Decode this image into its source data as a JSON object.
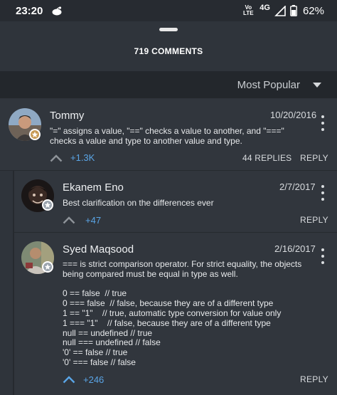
{
  "status": {
    "time": "23:20",
    "volte_top": "Vo",
    "volte_bottom": "LTE",
    "network": "4G",
    "battery": "62%"
  },
  "sheet": {
    "comments_count": "719 COMMENTS",
    "sort_label": "Most Popular"
  },
  "comments": [
    {
      "author": "Tommy",
      "date": "10/20/2016",
      "text": "\"=\" assigns a value, \"==\" checks a value to another, and \"===\" checks a value and type to another value and type.",
      "votes": "+1.3K",
      "replies": "44 REPLIES",
      "reply_label": "REPLY"
    },
    {
      "author": "Ekanem Eno",
      "date": "2/7/2017",
      "text": "Best clarification on the differences ever",
      "votes": "+47",
      "reply_label": "REPLY"
    },
    {
      "author": "Syed Maqsood",
      "date": "2/16/2017",
      "text": "=== is strict comparison operator. For strict equality, the objects being compared must be equal in type as well.\n\n0 == false  // true\n0 === false  // false, because they are of a different type\n1 == \"1\"    // true, automatic type conversion for value only\n1 === \"1\"    // false, because they are of a different type\nnull == undefined // true\nnull === undefined // false\n'0' == false // true\n'0' === false // false",
      "votes": "+246",
      "reply_label": "REPLY"
    }
  ],
  "colors": {
    "accent": "#5aa5e6",
    "upvote_inactive": "#8e9399",
    "upvote_active": "#5aa5e6",
    "background": "#31363d",
    "sortbar": "#23272c"
  },
  "icons": [
    "app-icon",
    "signal-icon",
    "battery-icon",
    "chevron-down-icon",
    "more-vert-icon",
    "upvote-icon",
    "star-badge-icon"
  ]
}
